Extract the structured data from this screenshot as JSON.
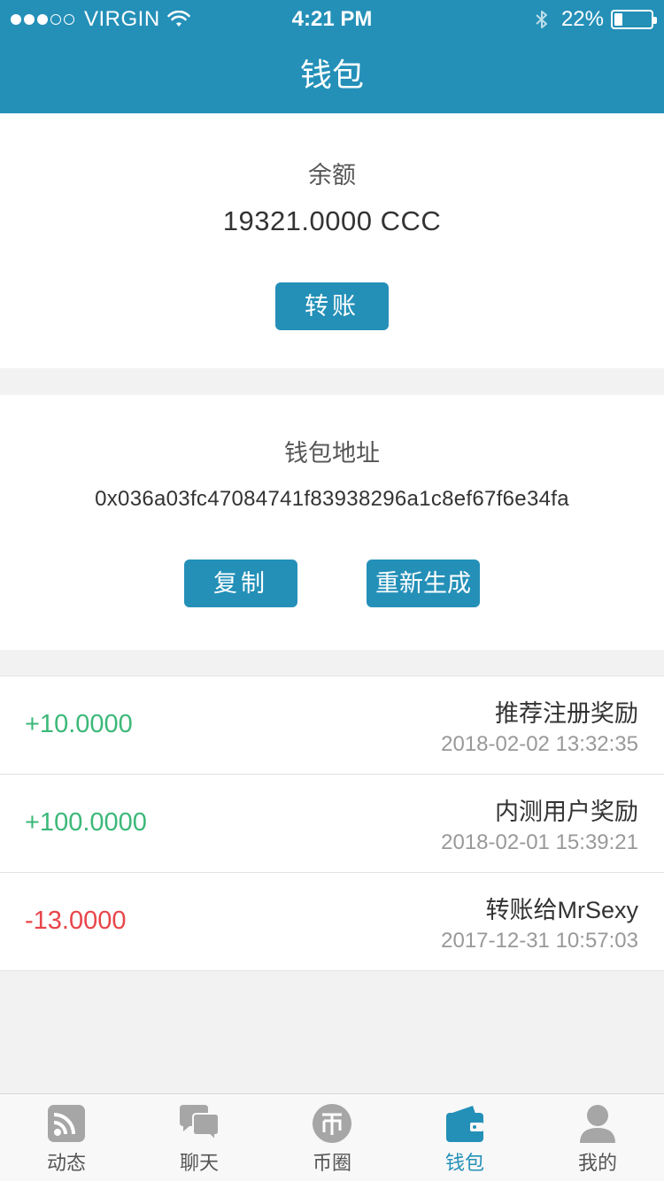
{
  "status_bar": {
    "carrier": "VIRGIN",
    "time": "4:21 PM",
    "battery": "22%",
    "battery_level": 0.22,
    "signal_bars_filled": 3,
    "signal_bars_total": 5
  },
  "nav": {
    "title": "钱包"
  },
  "balance_card": {
    "label": "余额",
    "amount": "19321.0000 CCC",
    "transfer_button": "转账"
  },
  "address_card": {
    "label": "钱包地址",
    "address": "0x036a03fc47084741f83938296a1c8ef67f6e34fa",
    "copy_button": "复制",
    "regenerate_button": "重新生成"
  },
  "transactions": [
    {
      "amount": "+10.0000",
      "title": "推荐注册奖励",
      "time": "2018-02-02 13:32:35",
      "type": "positive"
    },
    {
      "amount": "+100.0000",
      "title": "内测用户奖励",
      "time": "2018-02-01 15:39:21",
      "type": "positive"
    },
    {
      "amount": "-13.0000",
      "title": "转账给MrSexy",
      "time": "2017-12-31 10:57:03",
      "type": "negative"
    }
  ],
  "tab_bar": {
    "items": [
      {
        "label": "动态",
        "icon": "rss-feed-icon"
      },
      {
        "label": "聊天",
        "icon": "chat-bubbles-icon"
      },
      {
        "label": "币圈",
        "icon": "coin-icon"
      },
      {
        "label": "钱包",
        "icon": "wallet-icon",
        "active": true
      },
      {
        "label": "我的",
        "icon": "user-profile-icon"
      }
    ]
  },
  "colors": {
    "primary": "#2490b8",
    "positive": "#3cb879",
    "negative": "#e8454a",
    "inactive_icon": "#a6a6a6"
  }
}
